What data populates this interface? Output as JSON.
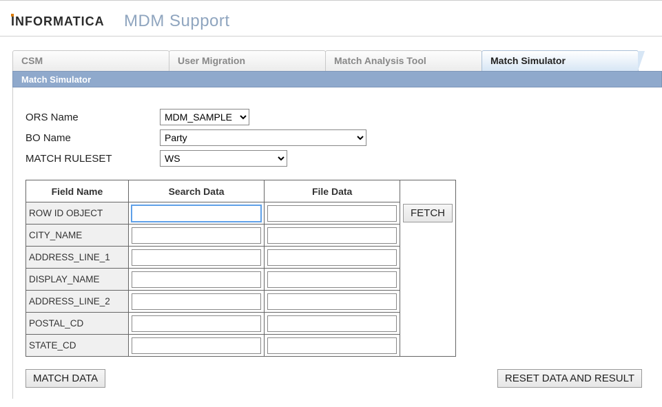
{
  "app": {
    "title": "MDM Support",
    "brand": "INFORMATICA"
  },
  "tabs": {
    "items": [
      {
        "label": "CSM",
        "active": false
      },
      {
        "label": "User Migration",
        "active": false
      },
      {
        "label": "Match Analysis Tool",
        "active": false
      },
      {
        "label": "Match Simulator",
        "active": true
      }
    ],
    "subheader": "Match Simulator"
  },
  "form": {
    "ors": {
      "label": "ORS Name",
      "value": "MDM_SAMPLE"
    },
    "bo": {
      "label": "BO Name",
      "value": "Party"
    },
    "rules": {
      "label": "MATCH RULESET",
      "value": "WS"
    }
  },
  "grid": {
    "headers": {
      "field": "Field Name",
      "search": "Search Data",
      "file": "File Data"
    },
    "fetch_label": "FETCH",
    "rows": [
      {
        "field": "ROW ID OBJECT",
        "search": "",
        "file": "",
        "fetch": true
      },
      {
        "field": "CITY_NAME",
        "search": "",
        "file": ""
      },
      {
        "field": "ADDRESS_LINE_1",
        "search": "",
        "file": ""
      },
      {
        "field": "DISPLAY_NAME",
        "search": "",
        "file": ""
      },
      {
        "field": "ADDRESS_LINE_2",
        "search": "",
        "file": ""
      },
      {
        "field": "POSTAL_CD",
        "search": "",
        "file": ""
      },
      {
        "field": "STATE_CD",
        "search": "",
        "file": ""
      }
    ]
  },
  "buttons": {
    "match": "MATCH DATA",
    "reset": "RESET DATA AND RESULT"
  }
}
